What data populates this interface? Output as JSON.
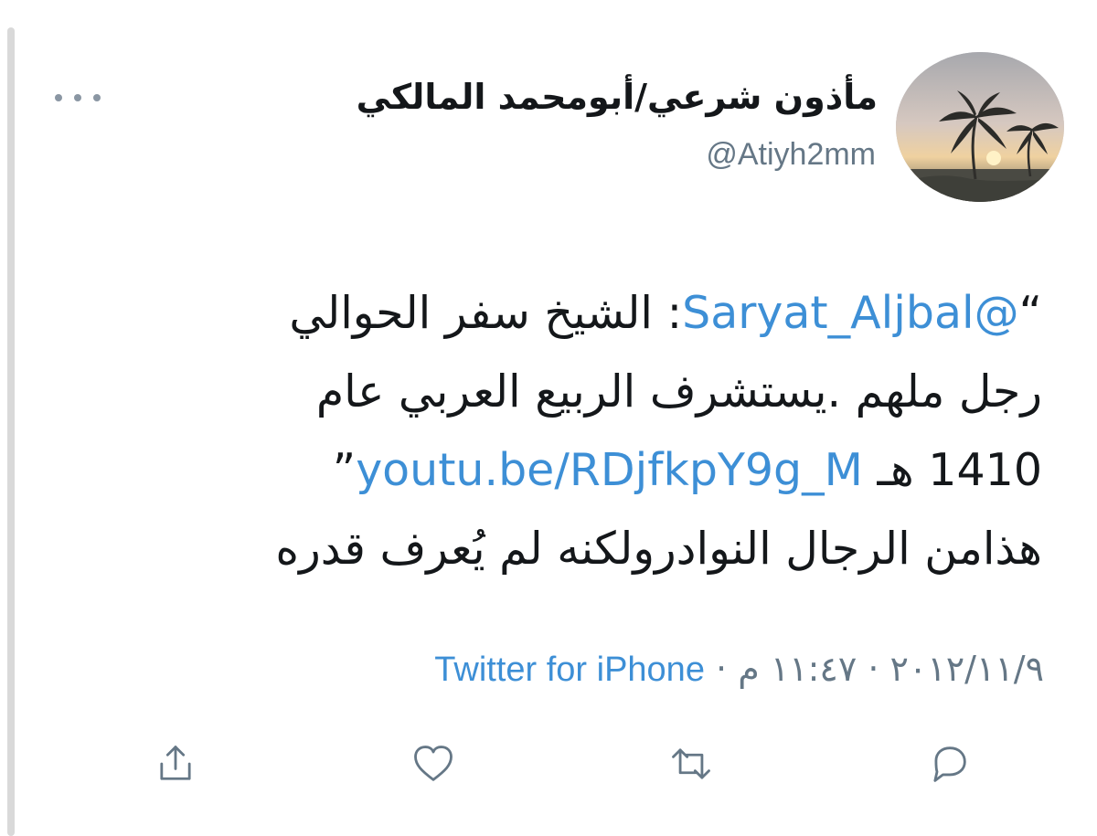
{
  "author": {
    "display_name": "مأذون شرعي/أبومحمد المالكي",
    "handle": "@Atiyh2mm"
  },
  "tweet": {
    "lines": [
      {
        "prefix": "“",
        "mention": "@Saryat_Aljbal",
        "text": ": الشيخ سفر الحوالي"
      },
      {
        "text": "رجل ملهم .يستشرف الربيع العربي عام"
      },
      {
        "text_before_link": "1410 هـ",
        "link": "youtu.be/RDjfkpY9g_M",
        "suffix": "”"
      },
      {
        "text": "هذامن الرجال النوادرولكنه لم يُعرف قدره"
      }
    ]
  },
  "meta": {
    "date": "٢٠١٢/١١/٩",
    "separator_1": " · ",
    "time": "١١:٤٧ م",
    "separator_2": " · ",
    "source": "Twitter for iPhone"
  },
  "actions": {
    "share": "share-icon",
    "like": "heart-icon",
    "retweet": "retweet-icon",
    "reply": "reply-icon"
  },
  "colors": {
    "link": "#3d8fd6",
    "muted": "#657786",
    "text": "#14171a"
  }
}
